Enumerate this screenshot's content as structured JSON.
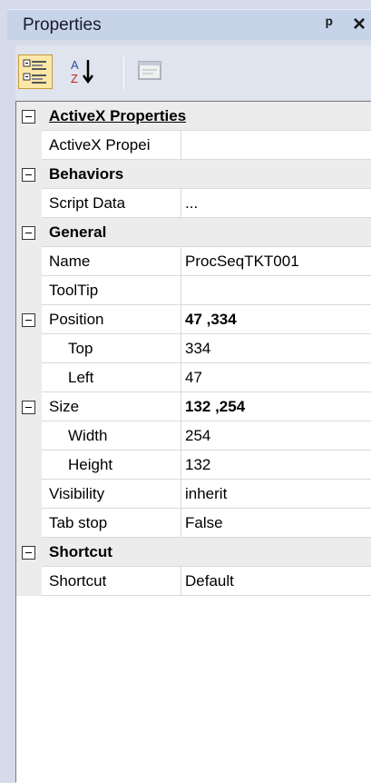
{
  "panel": {
    "title": "Properties",
    "pin_icon": "pushpin-icon",
    "close_icon": "close-icon"
  },
  "toolbar": {
    "categorized_icon": "categorized-view-icon",
    "alphabetical_icon": "sort-alphabetical-icon",
    "property_pages_icon": "property-pages-icon"
  },
  "grid": {
    "activex_cat": "ActiveX Properties",
    "activex_prop": "ActiveX Propei",
    "behaviors_cat": "Behaviors",
    "script_data_label": "Script Data",
    "script_data_value": "...",
    "general_cat": "General",
    "name_label": "Name",
    "name_value": "ProcSeqTKT001",
    "tooltip_label": "ToolTip",
    "tooltip_value": "",
    "position_label": "Position",
    "position_value": "47 ,334",
    "top_label": "Top",
    "top_value": "334",
    "left_label": "Left",
    "left_value": "47",
    "size_label": "Size",
    "size_value": "132 ,254",
    "width_label": "Width",
    "width_value": "254",
    "height_label": "Height",
    "height_value": "132",
    "visibility_label": "Visibility",
    "visibility_value": "inherit",
    "tabstop_label": "Tab stop",
    "tabstop_value": "False",
    "shortcut_cat": "Shortcut",
    "shortcut_label": "Shortcut",
    "shortcut_value": "Default"
  },
  "colors": {
    "background": "#d6dbe9",
    "titlebar": "#c6d3e9",
    "category_row": "#ececec",
    "selected_button": "#fbe7a8"
  }
}
